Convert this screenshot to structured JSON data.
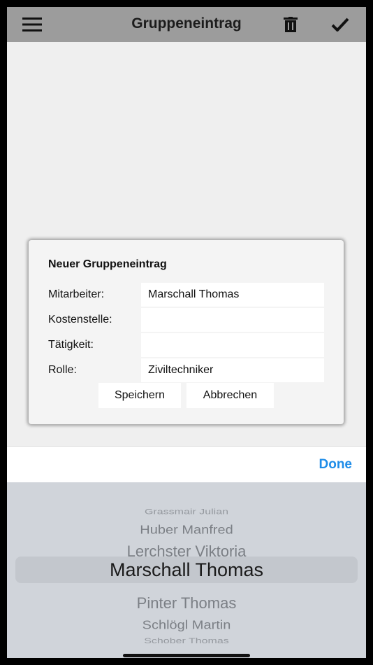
{
  "navbar": {
    "title": "Gruppeneintrag",
    "icons": {
      "menu": "hamburger-menu-icon",
      "delete": "trash-icon",
      "confirm": "checkmark-icon"
    }
  },
  "dialog": {
    "title": "Neuer Gruppeneintrag",
    "fields": {
      "mitarbeiter": {
        "label": "Mitarbeiter:",
        "value": "Marschall Thomas"
      },
      "kostenstelle": {
        "label": "Kostenstelle:",
        "value": ""
      },
      "taetigkeit": {
        "label": "Tätigkeit:",
        "value": ""
      },
      "rolle": {
        "label": "Rolle:",
        "value": "Ziviltechniker"
      }
    },
    "save_label": "Speichern",
    "cancel_label": "Abbrechen"
  },
  "picker": {
    "done_label": "Done",
    "accent_color": "#1e8ce8",
    "items": [
      "Grassmair Julian",
      "Huber Manfred",
      "Lerchster Viktoria",
      "Marschall Thomas",
      "Pinter Thomas",
      "Schlögl Martin",
      "Schober Thomas"
    ],
    "selected_item": "Marschall Thomas"
  }
}
